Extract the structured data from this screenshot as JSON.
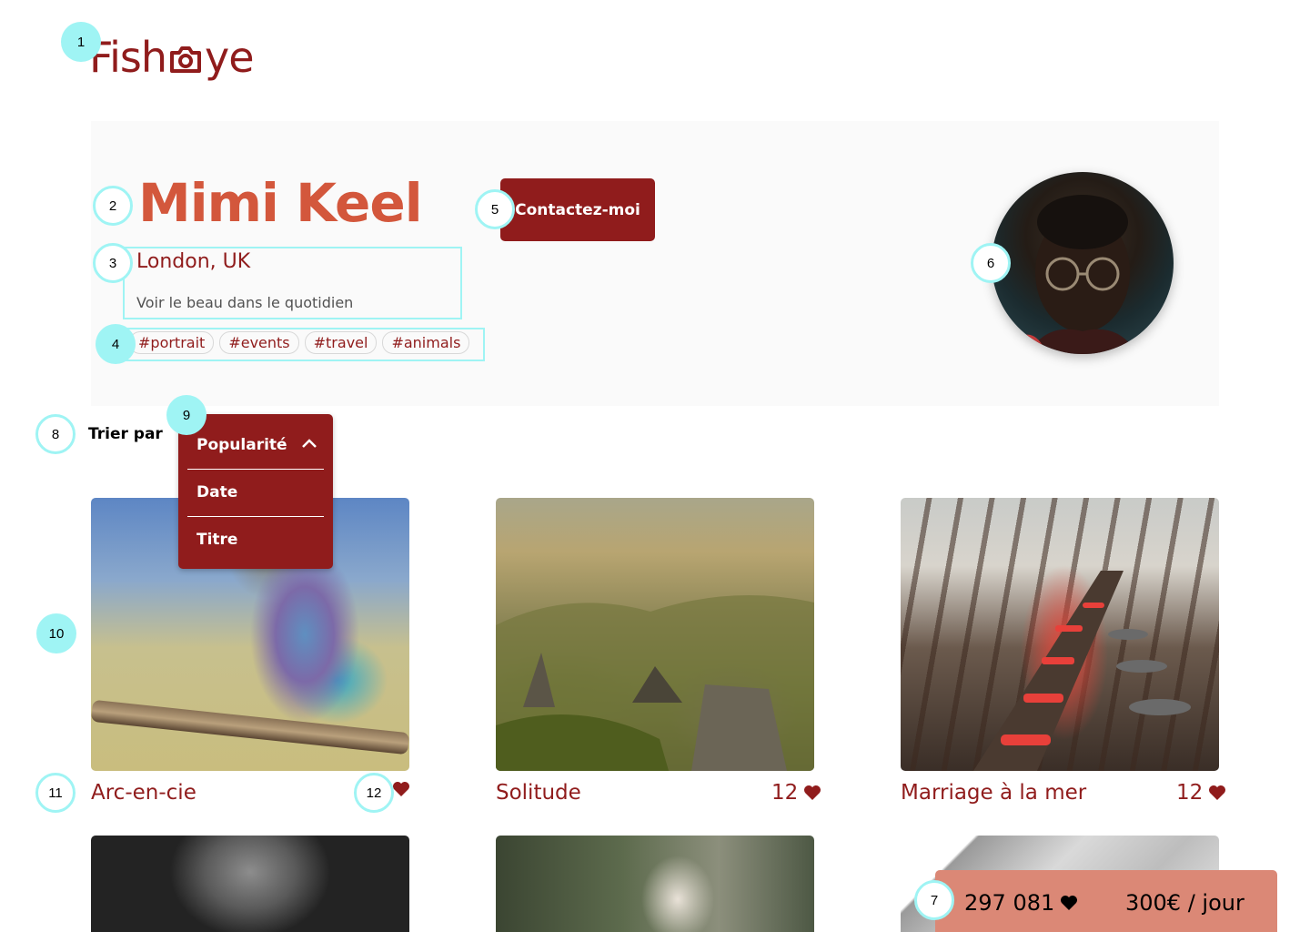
{
  "logo": {
    "text_before": "Fish",
    "text_after": "ye",
    "icon": "camera-icon"
  },
  "photographer": {
    "name": "Mimi Keel",
    "location": "London, UK",
    "tagline": "Voir le beau dans le quotidien",
    "tags": [
      "#portrait",
      "#events",
      "#travel",
      "#animals"
    ],
    "contact_label": "Contactez-moi"
  },
  "sort": {
    "label": "Trier par",
    "options": [
      "Popularité",
      "Date",
      "Titre"
    ],
    "selected": "Popularité",
    "expanded": true
  },
  "media": [
    {
      "title": "Arc-en-cie",
      "likes": ""
    },
    {
      "title": "Solitude",
      "likes": "12"
    },
    {
      "title": "Marriage à la mer",
      "likes": "12"
    },
    {
      "title": "",
      "likes": ""
    },
    {
      "title": "",
      "likes": ""
    },
    {
      "title": "",
      "likes": ""
    }
  ],
  "stats": {
    "total_likes": "297 081",
    "price": "300€ / jour"
  },
  "markers": [
    "1",
    "2",
    "3",
    "4",
    "5",
    "6",
    "7",
    "8",
    "9",
    "10",
    "11",
    "12"
  ],
  "colors": {
    "primary": "#901C1C",
    "accent": "#D3573C",
    "stats_bg": "#DB8876",
    "marker": "#9FF4F4",
    "banner_bg": "#FAFAFA"
  }
}
